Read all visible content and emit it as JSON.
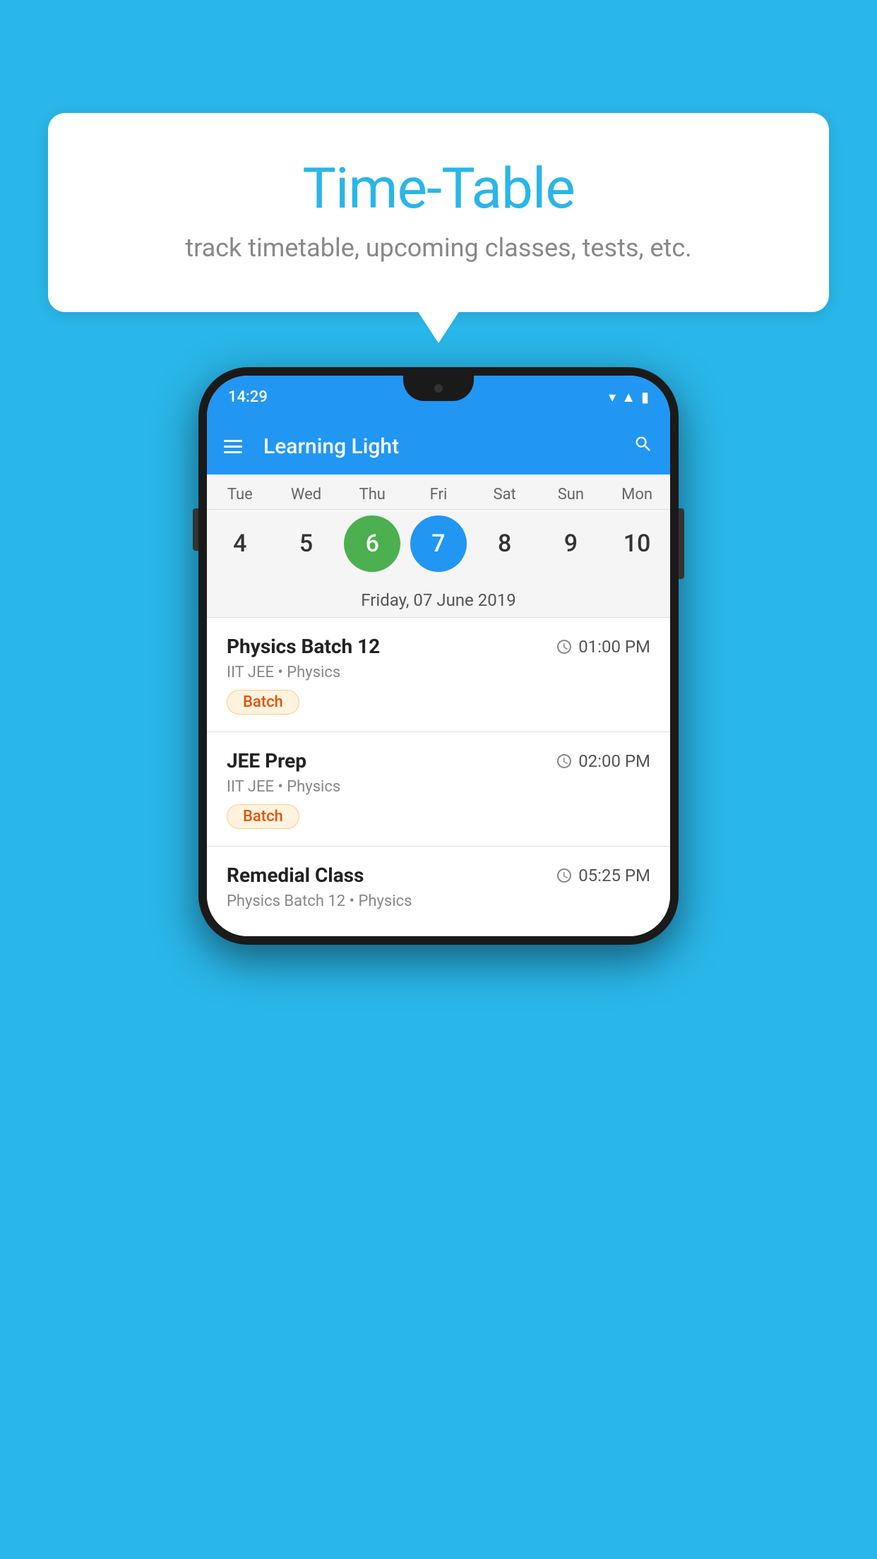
{
  "background": {
    "color": "#29b6e8"
  },
  "speech_bubble": {
    "title": "Time-Table",
    "subtitle": "track timetable, upcoming classes, tests, etc."
  },
  "phone": {
    "status_bar": {
      "time": "14:29",
      "icons": [
        "wifi",
        "signal",
        "battery"
      ]
    },
    "app_bar": {
      "title": "Learning Light",
      "menu_icon": "hamburger",
      "search_icon": "search"
    },
    "calendar": {
      "days": [
        "Tue",
        "Wed",
        "Thu",
        "Fri",
        "Sat",
        "Sun",
        "Mon"
      ],
      "dates": [
        {
          "num": "4",
          "state": "normal"
        },
        {
          "num": "5",
          "state": "normal"
        },
        {
          "num": "6",
          "state": "today"
        },
        {
          "num": "7",
          "state": "selected"
        },
        {
          "num": "8",
          "state": "normal"
        },
        {
          "num": "9",
          "state": "normal"
        },
        {
          "num": "10",
          "state": "normal"
        }
      ],
      "selected_date_label": "Friday, 07 June 2019"
    },
    "schedule": [
      {
        "title": "Physics Batch 12",
        "time": "01:00 PM",
        "subtitle": "IIT JEE • Physics",
        "badge": "Batch"
      },
      {
        "title": "JEE Prep",
        "time": "02:00 PM",
        "subtitle": "IIT JEE • Physics",
        "badge": "Batch"
      },
      {
        "title": "Remedial Class",
        "time": "05:25 PM",
        "subtitle": "Physics Batch 12 • Physics",
        "badge": null
      }
    ]
  }
}
